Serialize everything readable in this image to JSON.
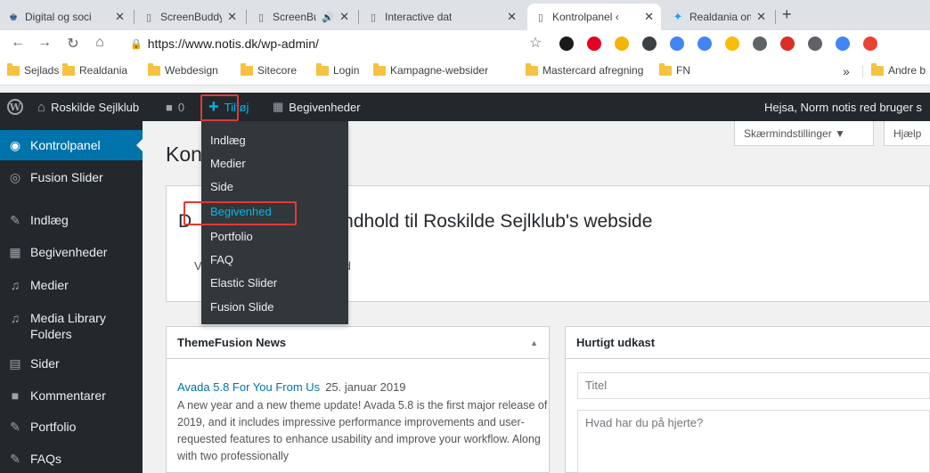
{
  "browser": {
    "tabs": [
      {
        "title": "Digital og soci",
        "icon": "govt-icon"
      },
      {
        "title": "ScreenBuddy",
        "icon": "page-icon"
      },
      {
        "title": "ScreenBuc",
        "icon": "page-icon",
        "audio": "🔊"
      },
      {
        "title": "Interactive dat",
        "icon": "page-icon"
      },
      {
        "title": "Kontrolpanel ‹",
        "icon": "page-icon"
      },
      {
        "title": "Realdania on T",
        "icon": "twitter-icon"
      }
    ],
    "tab_close_glyph": "✕",
    "new_tab_glyph": "+",
    "url": "https://www.notis.dk/wp-admin/",
    "bookmarks": [
      "Sejlads",
      "Realdania",
      "Webdesign",
      "Sitecore",
      "Login",
      "Kampagne-websider",
      "Mastercard afregning",
      "FN"
    ],
    "bookmarks_overflow": "»",
    "other_bookmarks": "Andre b",
    "extension_colors": [
      "#1a1a1a",
      "#e60023",
      "#f4b400",
      "#3c4043",
      "#4285f4",
      "#4285f4",
      "#fbbc05",
      "#5f6368",
      "#d93025",
      "#5f6368",
      "#4285f4",
      "#ea4335"
    ]
  },
  "adminbar": {
    "wp_glyph": "W",
    "site_name": "Roskilde Sejlklub",
    "comments_count": "0",
    "add_label": "Tilføj",
    "events_label": "Begivenheder",
    "greeting": "Hejsa, Norm notis red bruger s"
  },
  "add_menu": {
    "items": [
      "Indlæg",
      "Medier",
      "Side",
      "Begivenhed",
      "Portfolio",
      "FAQ",
      "Elastic Slider",
      "Fusion Slide"
    ],
    "highlighted": "Begivenhed"
  },
  "sidebar": {
    "items": [
      {
        "label": "Kontrolpanel",
        "icon": "dashboard-icon"
      },
      {
        "label": "Fusion Slider",
        "icon": "slider-icon"
      },
      {
        "label": "Indlæg",
        "icon": "pin-icon"
      },
      {
        "label": "Begivenheder",
        "icon": "calendar-icon"
      },
      {
        "label": "Medier",
        "icon": "media-icon"
      },
      {
        "label": "Media Library",
        "label2": "Folders",
        "icon": "media-icon"
      },
      {
        "label": "Sider",
        "icon": "page-icon"
      },
      {
        "label": "Kommentarer",
        "icon": "comment-icon"
      },
      {
        "label": "Portfolio",
        "icon": "pin-icon"
      },
      {
        "label": "FAQs",
        "icon": "pin-icon"
      }
    ]
  },
  "main": {
    "title": "Kon",
    "screen_options": "Skærmindstillinger ▼",
    "help": "Hjælp",
    "welcome_heading_prefix": "D",
    "welcome_heading": "ndhold til Roskilde Sejlklub's webside",
    "welcome_sub_prefix": "V",
    "welcome_sub_suffix": "d"
  },
  "news": {
    "title": "ThemeFusion News",
    "toggle": "▲",
    "item_title": "Avada 5.8 For You From Us",
    "item_date": "25. januar 2019",
    "item_excerpt": "A new year and a new theme update! Avada 5.8 is the first major release of 2019, and it includes impressive performance improvements and user-requested features to enhance usability and improve your workflow. Along with two professionally"
  },
  "quick_draft": {
    "title": "Hurtigt udkast",
    "title_placeholder": "Titel",
    "content_placeholder": "Hvad har du på hjerte?"
  }
}
